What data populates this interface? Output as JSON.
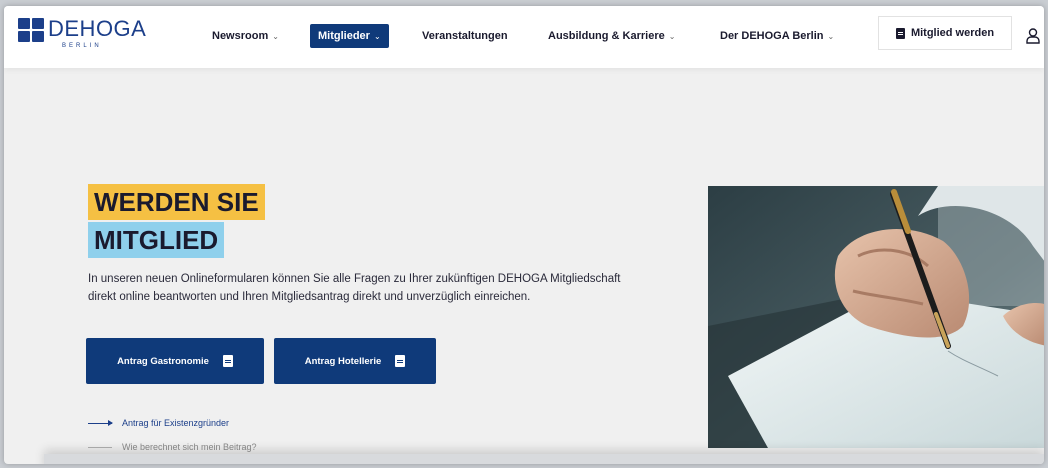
{
  "brand": {
    "name": "DEHOGA",
    "sub": "BERLIN",
    "color": "#1c3f8a"
  },
  "nav": {
    "items": [
      {
        "label": "Newsroom",
        "chevron": true
      },
      {
        "label": "Mitglieder",
        "chevron": true,
        "active": true
      },
      {
        "label": "Veranstaltungen",
        "chevron": false
      },
      {
        "label": "Ausbildung & Karriere",
        "chevron": true
      },
      {
        "label": "Der DEHOGA Berlin",
        "chevron": true
      }
    ],
    "cta_label": "Mitglied werden",
    "user_icon": "user-icon"
  },
  "hero": {
    "title_line1": "WERDEN SIE",
    "title_line2": "MITGLIED",
    "intro": "In unseren neuen Onlineformularen können Sie alle Fragen zu Ihrer zukünftigen DEHOGA Mitgliedschaft direkt online beantworten und Ihren Mitgliedsantrag direkt und unverzüglich einreichen.",
    "buttons": [
      {
        "label": "Antrag Gastronomie",
        "icon": "document-icon"
      },
      {
        "label": "Antrag Hotellerie",
        "icon": "document-icon"
      }
    ],
    "links": [
      {
        "label": "Antrag für Existenzgründer"
      },
      {
        "label": "Wie berechnet sich mein Beitrag?"
      }
    ]
  },
  "colors": {
    "primary": "#0f3a7a",
    "highlight_yellow": "#f5c043",
    "highlight_blue": "#8fd0ec"
  }
}
